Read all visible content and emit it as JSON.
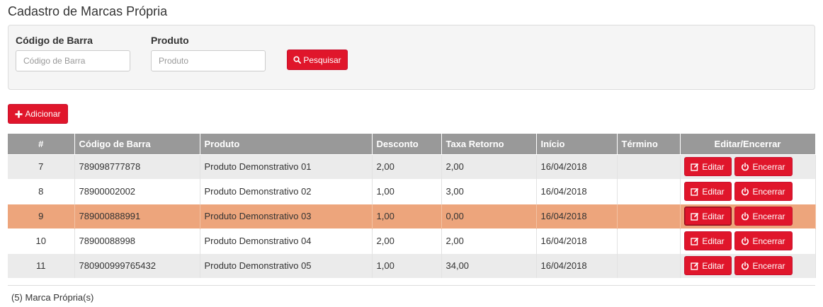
{
  "page": {
    "title": "Cadastro de Marcas Própria"
  },
  "filters": {
    "barcode": {
      "label": "Código de Barra",
      "placeholder": "Código de Barra",
      "value": ""
    },
    "product": {
      "label": "Produto",
      "placeholder": "Produto",
      "value": ""
    },
    "search_label": "Pesquisar"
  },
  "toolbar": {
    "add_label": "Adicionar"
  },
  "table": {
    "columns": [
      "#",
      "Código de Barra",
      "Produto",
      "Desconto",
      "Taxa Retorno",
      "Início",
      "Término",
      "Editar/Encerrar"
    ],
    "edit_label": "Editar",
    "close_label": "Encerrar",
    "rows": [
      {
        "id": "7",
        "barcode": "789098777878",
        "product": "Produto Demonstrativo 01",
        "discount": "2,00",
        "return_rate": "2,00",
        "start": "16/04/2018",
        "end": ""
      },
      {
        "id": "8",
        "barcode": "78900002002",
        "product": "Produto Demonstrativo 02",
        "discount": "1,00",
        "return_rate": "3,00",
        "start": "16/04/2018",
        "end": ""
      },
      {
        "id": "9",
        "barcode": "789000888991",
        "product": "Produto Demonstrativo 03",
        "discount": "1,00",
        "return_rate": "0,00",
        "start": "16/04/2018",
        "end": ""
      },
      {
        "id": "10",
        "barcode": "78900088998",
        "product": "Produto Demonstrativo 04",
        "discount": "2,00",
        "return_rate": "2,00",
        "start": "16/04/2018",
        "end": ""
      },
      {
        "id": "11",
        "barcode": "780900999765432",
        "product": "Produto Demonstrativo 05",
        "discount": "1,00",
        "return_rate": "34,00",
        "start": "16/04/2018",
        "end": ""
      }
    ],
    "selected_row": 2
  },
  "footer": {
    "count_text": "(5) Marca Própria(s)"
  },
  "colors": {
    "accent": "#e0162b",
    "header": "#999999",
    "selected_row": "#eda57c"
  },
  "icons": {
    "search": "search-icon",
    "add": "plus-icon",
    "edit": "edit-icon",
    "close": "power-icon"
  }
}
